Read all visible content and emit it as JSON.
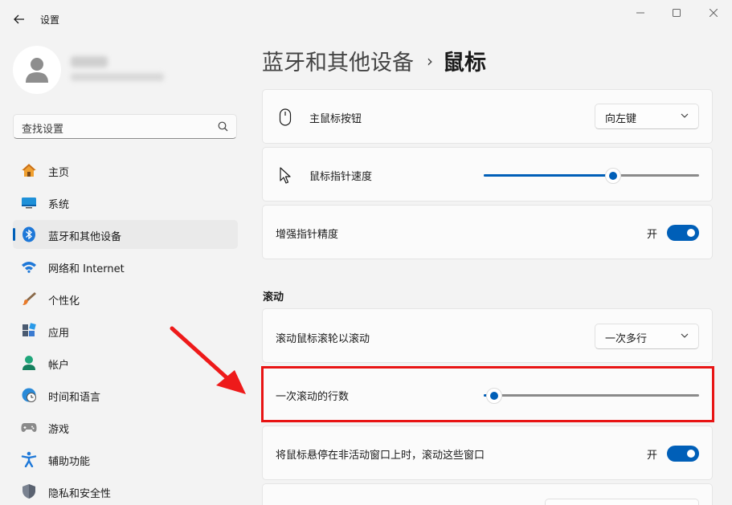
{
  "window": {
    "title": "设置"
  },
  "search": {
    "placeholder": "查找设置"
  },
  "sidebar": {
    "items": [
      {
        "label": "主页",
        "icon": "home-icon"
      },
      {
        "label": "系统",
        "icon": "monitor-icon"
      },
      {
        "label": "蓝牙和其他设备",
        "icon": "bluetooth-icon",
        "selected": true
      },
      {
        "label": "网络和 Internet",
        "icon": "wifi-icon"
      },
      {
        "label": "个性化",
        "icon": "brush-icon"
      },
      {
        "label": "应用",
        "icon": "apps-icon"
      },
      {
        "label": "帐户",
        "icon": "account-icon"
      },
      {
        "label": "时间和语言",
        "icon": "clock-globe-icon"
      },
      {
        "label": "游戏",
        "icon": "gamepad-icon"
      },
      {
        "label": "辅助功能",
        "icon": "accessibility-icon"
      },
      {
        "label": "隐私和安全性",
        "icon": "shield-icon"
      }
    ]
  },
  "breadcrumb": {
    "parent": "蓝牙和其他设备",
    "separator": "›",
    "current": "鼠标"
  },
  "settings": {
    "primary_button": {
      "label": "主鼠标按钮",
      "value": "向左键",
      "icon": "mouse-icon"
    },
    "pointer_speed": {
      "label": "鼠标指针速度",
      "level": 0.6,
      "icon": "cursor-icon"
    },
    "precision": {
      "label": "增强指针精度",
      "state": "开"
    },
    "scroll_section": "滚动",
    "scroll_mode": {
      "label": "滚动鼠标滚轮以滚动",
      "value": "一次多行"
    },
    "scroll_lines": {
      "label": "一次滚动的行数",
      "level": 0.05
    },
    "inactive_scroll": {
      "label": "将鼠标悬停在非活动窗口上时，滚动这些窗口",
      "state": "开"
    }
  },
  "colors": {
    "accent": "#005fb8",
    "highlight": "#e81414"
  }
}
